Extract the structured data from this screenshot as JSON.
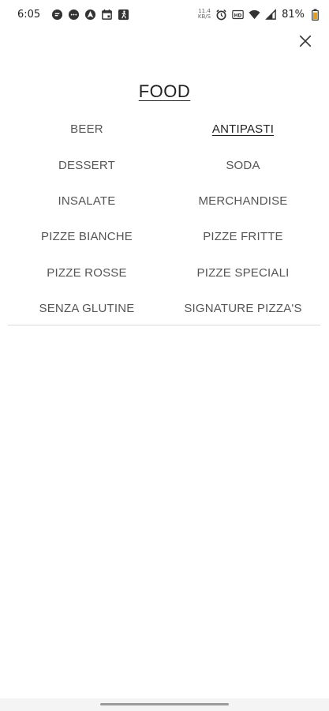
{
  "status_bar": {
    "time": "6:05",
    "speed_value": "11.4",
    "speed_unit": "KB/S",
    "battery_pct": "81%",
    "left_icons": [
      "chat-icon",
      "message-icon",
      "nav-app-icon",
      "calendar-icon",
      "fitness-icon"
    ],
    "right_icons": [
      "alarm-icon",
      "hd-icon",
      "wifi-icon",
      "signal-icon",
      "battery-icon"
    ]
  },
  "menu": {
    "title": "FOOD",
    "close_icon": "close-icon",
    "categories": [
      {
        "label": "BEER",
        "active": false
      },
      {
        "label": "ANTIPASTI",
        "active": true
      },
      {
        "label": "DESSERT",
        "active": false
      },
      {
        "label": "SODA",
        "active": false
      },
      {
        "label": "INSALATE",
        "active": false
      },
      {
        "label": "MERCHANDISE",
        "active": false
      },
      {
        "label": "PIZZE BIANCHE",
        "active": false
      },
      {
        "label": "PIZZE FRITTE",
        "active": false
      },
      {
        "label": "PIZZE ROSSE",
        "active": false
      },
      {
        "label": "PIZZE SPECIALI",
        "active": false
      },
      {
        "label": "SENZA GLUTINE",
        "active": false
      },
      {
        "label": "SIGNATURE PIZZA'S",
        "active": false
      }
    ]
  }
}
